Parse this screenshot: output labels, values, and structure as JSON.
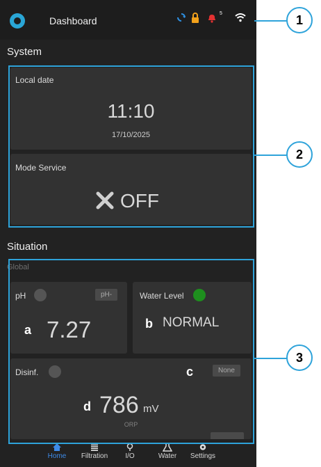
{
  "header": {
    "title": "Dashboard",
    "notif_count": "5"
  },
  "icons": [
    "sync-icon",
    "lock-icon",
    "bell-icon",
    "wifi-icon"
  ],
  "system": {
    "section_title": "System",
    "local_date_label": "Local date",
    "time": "11:10",
    "date": "17/10/2025",
    "mode_label": "Mode Service",
    "mode_value": "OFF"
  },
  "situation": {
    "section_title": "Situation",
    "global_label": "Global",
    "ph": {
      "label": "pH",
      "chip": "pH-",
      "value": "7.27"
    },
    "water_level": {
      "label": "Water Level",
      "value": "NORMAL"
    },
    "disinf": {
      "label": "Disinf.",
      "chip": "None",
      "value": "786",
      "unit": "mV",
      "sub": "ORP"
    }
  },
  "annotations": {
    "c1": "1",
    "c2": "2",
    "c3": "3",
    "a": "a",
    "b": "b",
    "c": "c",
    "d": "d"
  },
  "nav": [
    {
      "label": "Home"
    },
    {
      "label": "Filtration"
    },
    {
      "label": "I/O"
    },
    {
      "label": "Water"
    },
    {
      "label": "Settings"
    }
  ],
  "colors": {
    "accent": "#2ea3da",
    "active": "#3e8be8",
    "status_ok": "#1e8f1e"
  }
}
